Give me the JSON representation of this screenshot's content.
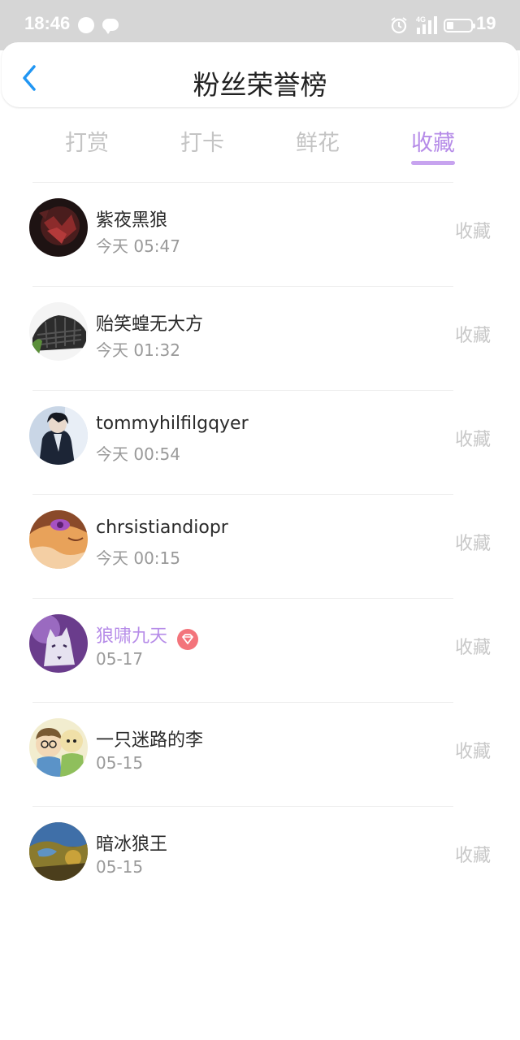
{
  "status_bar": {
    "time": "18:46",
    "network_label": "4G",
    "battery_level": "19",
    "icons": [
      "notification-dot-icon",
      "chat-bubble-icon",
      "alarm-icon",
      "signal-icon",
      "battery-icon"
    ]
  },
  "header": {
    "title": "粉丝荣誉榜",
    "back_icon": "chevron-left-icon",
    "accent_color": "#2196f3"
  },
  "tabs": [
    {
      "label": "打赏",
      "active": false
    },
    {
      "label": "打卡",
      "active": false
    },
    {
      "label": "鲜花",
      "active": false
    },
    {
      "label": "收藏",
      "active": true
    }
  ],
  "active_tab_color": "#b68ce8",
  "fans": [
    {
      "name": "紫夜黑狼",
      "time": "今天 05:47",
      "action": "收藏",
      "vip": false
    },
    {
      "name": "贻笑蝗无大方",
      "time": "今天 01:32",
      "action": "收藏",
      "vip": false
    },
    {
      "name": "tommyhilfilgqyer",
      "time": "今天 00:54",
      "action": "收藏",
      "vip": false
    },
    {
      "name": "chrsistiandiopr",
      "time": "今天 00:15",
      "action": "收藏",
      "vip": false
    },
    {
      "name": "狼啸九天",
      "time": "05-17",
      "action": "收藏",
      "vip": true,
      "badge_icon": "diamond-badge-icon",
      "badge_color": "#f3747b"
    },
    {
      "name": "一只迷路的李",
      "time": "05-15",
      "action": "收藏",
      "vip": false
    },
    {
      "name": "暗冰狼王",
      "time": "05-15",
      "action": "收藏",
      "vip": false
    }
  ]
}
